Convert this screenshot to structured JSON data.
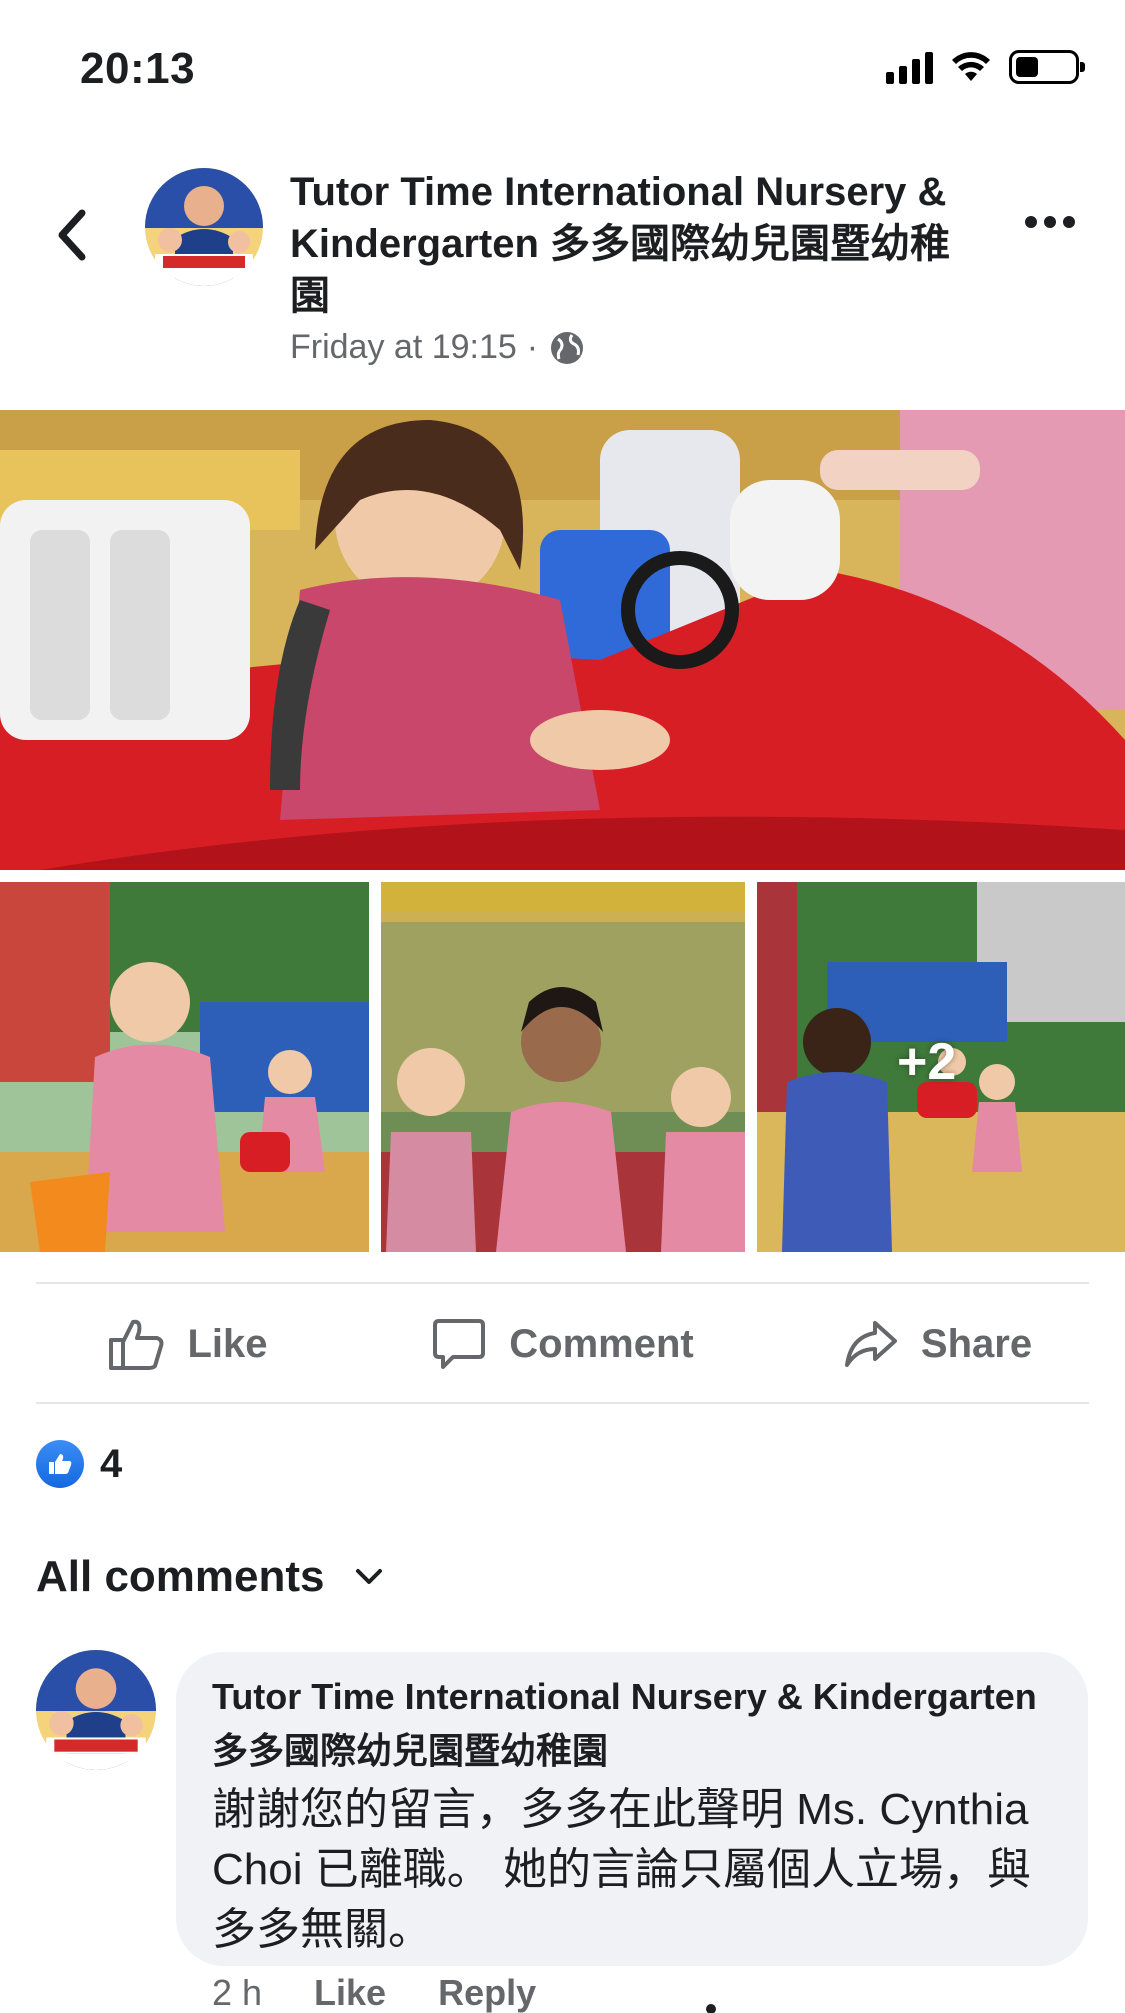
{
  "status_bar": {
    "time": "20:13",
    "icons": [
      "cellular-signal-icon",
      "wifi-icon",
      "battery-icon"
    ]
  },
  "post": {
    "page_name": "Tutor Time International Nursery & Kindergarten 多多國際幼兒園暨幼稚園",
    "timestamp": "Friday at 19:15",
    "separator": "·",
    "audience_icon": "globe-icon",
    "photos": {
      "extra_count": "+2"
    }
  },
  "actions": {
    "like": "Like",
    "comment": "Comment",
    "share": "Share"
  },
  "reactions": {
    "count": "4",
    "type": "like"
  },
  "comments": {
    "filter_label": "All comments",
    "items": [
      {
        "author": "Tutor Time International Nursery & Kindergarten 多多國際幼兒園暨幼稚園",
        "text": "謝謝您的留言，多多在此聲明 Ms. Cynthia Choi 已離職。 她的言論只屬個人立場，與多多無關。",
        "time": "2 h",
        "like_label": "Like",
        "reply_label": "Reply"
      }
    ]
  },
  "colors": {
    "facebook_blue": "#1877f2",
    "muted_text": "#65676b",
    "bubble_bg": "#f0f2f5",
    "divider": "#e4e6eb"
  }
}
